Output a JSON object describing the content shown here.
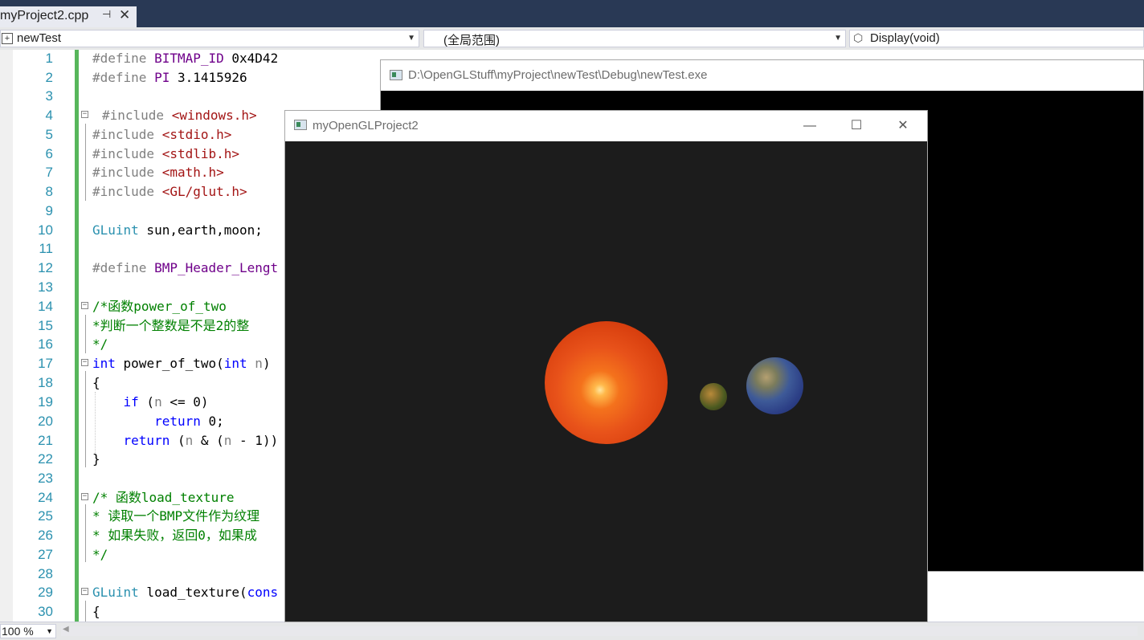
{
  "tab": {
    "title": "myProject2.cpp",
    "pin_glyph": "⊣",
    "close_glyph": "✕"
  },
  "navbar": {
    "project": "newTest",
    "scope": "(全局范围)",
    "member": "Display(void)"
  },
  "code_lines": [
    {
      "n": "1"
    },
    {
      "n": "2"
    },
    {
      "n": "3"
    },
    {
      "n": "4"
    },
    {
      "n": "5"
    },
    {
      "n": "6"
    },
    {
      "n": "7"
    },
    {
      "n": "8"
    },
    {
      "n": "9"
    },
    {
      "n": "10"
    },
    {
      "n": "11"
    },
    {
      "n": "12"
    },
    {
      "n": "13"
    },
    {
      "n": "14"
    },
    {
      "n": "15"
    },
    {
      "n": "16"
    },
    {
      "n": "17"
    },
    {
      "n": "18"
    },
    {
      "n": "19"
    },
    {
      "n": "20"
    },
    {
      "n": "21"
    },
    {
      "n": "22"
    },
    {
      "n": "23"
    },
    {
      "n": "24"
    },
    {
      "n": "25"
    },
    {
      "n": "26"
    },
    {
      "n": "27"
    },
    {
      "n": "28"
    },
    {
      "n": "29"
    },
    {
      "n": "30"
    }
  ],
  "code": {
    "l1": {
      "a": "#define ",
      "b": "BITMAP_ID",
      "c": " 0x4D42"
    },
    "l2": {
      "a": "#define ",
      "b": "PI",
      "c": " 3.1415926"
    },
    "l4": {
      "a": "#include ",
      "b": "<windows.h>"
    },
    "l5": {
      "a": "#include ",
      "b": "<stdio.h>"
    },
    "l6": {
      "a": "#include ",
      "b": "<stdlib.h>"
    },
    "l7": {
      "a": "#include ",
      "b": "<math.h>"
    },
    "l8": {
      "a": "#include ",
      "b": "<GL/glut.h>"
    },
    "l10": {
      "a": "GLuint",
      "b": " sun,earth,moon;"
    },
    "l12": {
      "a": "#define ",
      "b": "BMP_Header_Lengt"
    },
    "l14": {
      "a": "/*函数power_of_two"
    },
    "l15": {
      "a": "*判断一个整数是不是2的整"
    },
    "l16": {
      "a": "*/"
    },
    "l17": {
      "a": "int",
      "b": " power_of_two(",
      "c": "int",
      "d": " n",
      "e": ")"
    },
    "l18": {
      "a": "{"
    },
    "l19": {
      "a": "    ",
      "b": "if",
      "c": " (",
      "d": "n",
      "e": " <= 0)"
    },
    "l20": {
      "a": "        ",
      "b": "return",
      "c": " 0;"
    },
    "l21": {
      "a": "    ",
      "b": "return",
      "c": " (",
      "d": "n",
      "e": " & (",
      "f": "n",
      "g": " - 1))"
    },
    "l22": {
      "a": "}"
    },
    "l24": {
      "a": "/* 函数load_texture"
    },
    "l25": {
      "a": "* 读取一个BMP文件作为纹理"
    },
    "l26": {
      "a": "* 如果失败，返回0，如果成"
    },
    "l27": {
      "a": "*/"
    },
    "l29": {
      "a": "GLuint",
      "b": " load_texture(",
      "c": "cons"
    },
    "l30": {
      "a": "{"
    }
  },
  "status": {
    "zoom": "100 %"
  },
  "console_window": {
    "title": "D:\\OpenGLStuff\\myProject\\newTest\\Debug\\newTest.exe"
  },
  "gl_window": {
    "title": "myOpenGLProject2",
    "minimize_glyph": "—",
    "maximize_glyph": "☐",
    "close_glyph": "✕"
  },
  "colors": {
    "tabstrip": "#293955",
    "line_numbers": "#2b91af",
    "change_bar": "#57b65b"
  }
}
